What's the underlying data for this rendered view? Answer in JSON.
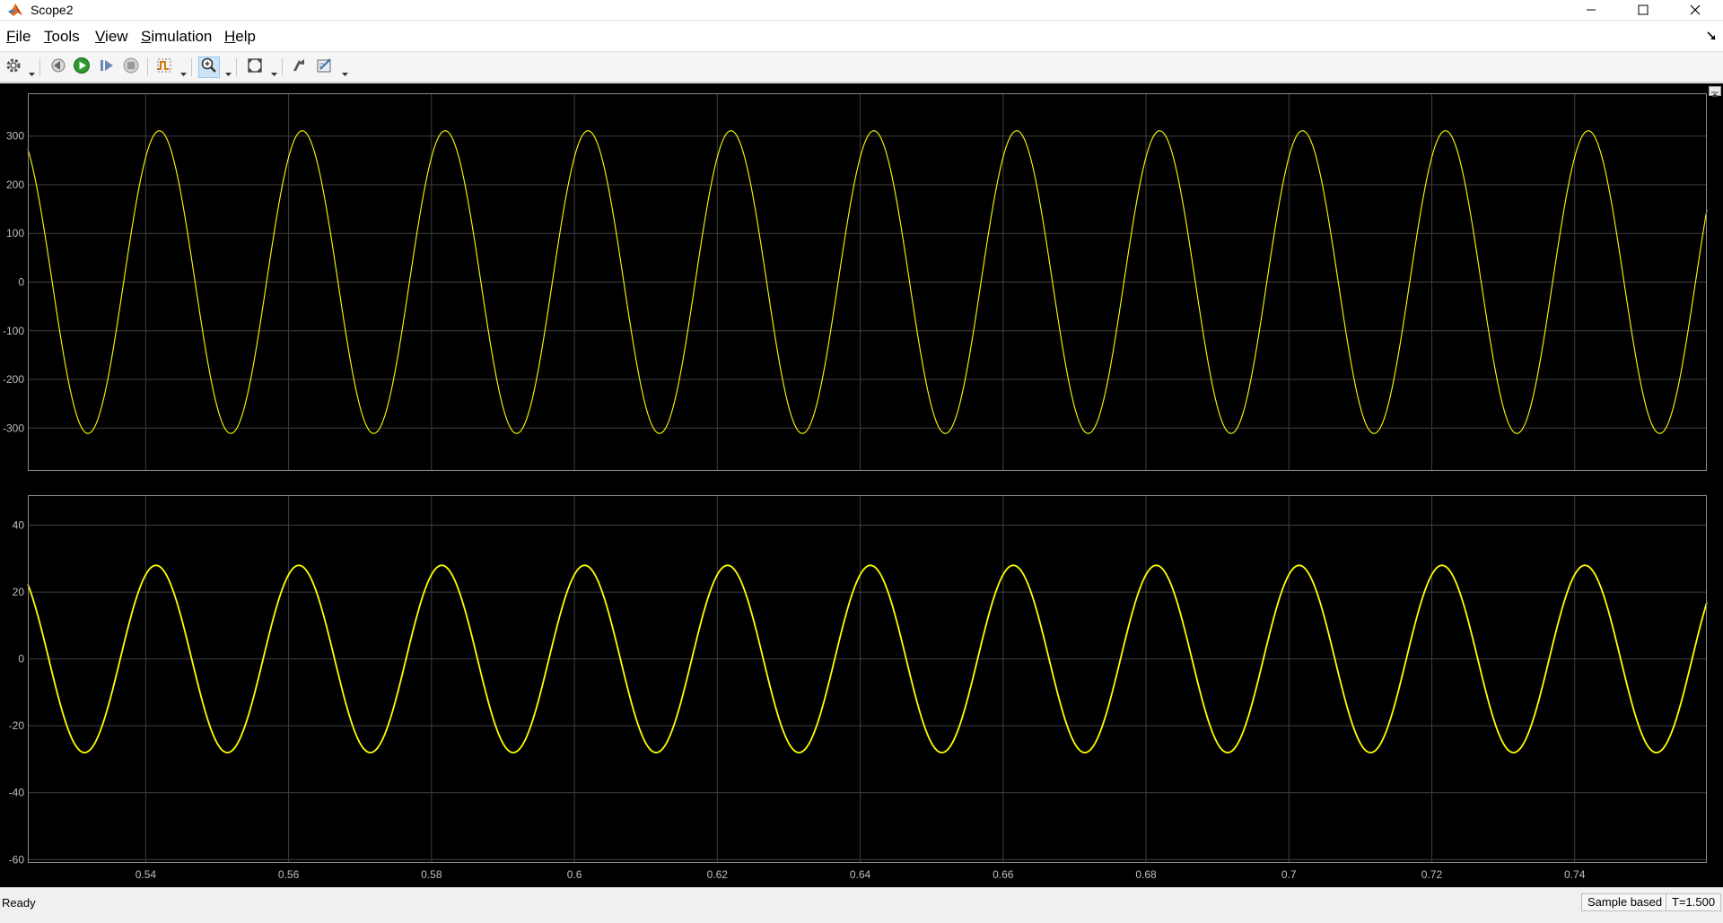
{
  "window": {
    "title": "Scope2",
    "app_icon": "matlab-icon"
  },
  "menu": {
    "items": [
      {
        "label": "File",
        "accel": "F",
        "rest": "ile"
      },
      {
        "label": "Tools",
        "accel": "T",
        "rest": "ools"
      },
      {
        "label": "View",
        "accel": "V",
        "rest": "iew"
      },
      {
        "label": "Simulation",
        "accel": "S",
        "rest": "imulation"
      },
      {
        "label": "Help",
        "accel": "H",
        "rest": "elp"
      }
    ]
  },
  "toolbar": {
    "buttons": [
      "settings-icon",
      "step-back-icon",
      "run-icon",
      "step-forward-icon",
      "stop-icon",
      "trigger-icon",
      "zoom-in-icon",
      "autoscale-icon",
      "highlight-simulink-block-icon",
      "measurements-icon"
    ]
  },
  "colors": {
    "plot_background": "#000000",
    "grid": "#3f3f3f",
    "axes_border": "#8c8c8c",
    "tick_text": "#bfbfbf",
    "signal": "#ffff00"
  },
  "chart_data": [
    {
      "type": "line",
      "title": "",
      "xlabel": "",
      "ylabel": "",
      "xlim": [
        0.5235,
        0.7585
      ],
      "ylim": [
        -388,
        388
      ],
      "yticks": [
        300,
        200,
        100,
        0,
        -100,
        -200,
        -300
      ],
      "ytick_labels": [
        "300",
        "200",
        "100",
        "0",
        "-100",
        "-200",
        "-300"
      ],
      "grid": true,
      "series": [
        {
          "color": "#ffff00",
          "waveform": "sine",
          "amplitude": 311,
          "frequency_hz": 50,
          "phase_rad": 0.97
        }
      ]
    },
    {
      "type": "line",
      "title": "",
      "xlabel": "",
      "ylabel": "",
      "xlim": [
        0.5235,
        0.7585
      ],
      "ylim": [
        -61,
        49
      ],
      "yticks": [
        40,
        20,
        0,
        -20,
        -40,
        -60
      ],
      "ytick_labels": [
        "40",
        "20",
        "0",
        "-20",
        "-40",
        "-60"
      ],
      "xticks": [
        0.54,
        0.56,
        0.58,
        0.6,
        0.62,
        0.64,
        0.66,
        0.68,
        0.7,
        0.72,
        0.74
      ],
      "xtick_labels": [
        "0.54",
        "0.56",
        "0.58",
        "0.6",
        "0.62",
        "0.64",
        "0.66",
        "0.68",
        "0.7",
        "0.72",
        "0.74"
      ],
      "grid": true,
      "series": [
        {
          "color": "#ffff00",
          "waveform": "sine",
          "amplitude": 28,
          "frequency_hz": 50,
          "phase_rad": 1.12
        }
      ]
    }
  ],
  "status": {
    "ready": "Ready",
    "sample_mode": "Sample based",
    "time": "T=1.500"
  }
}
